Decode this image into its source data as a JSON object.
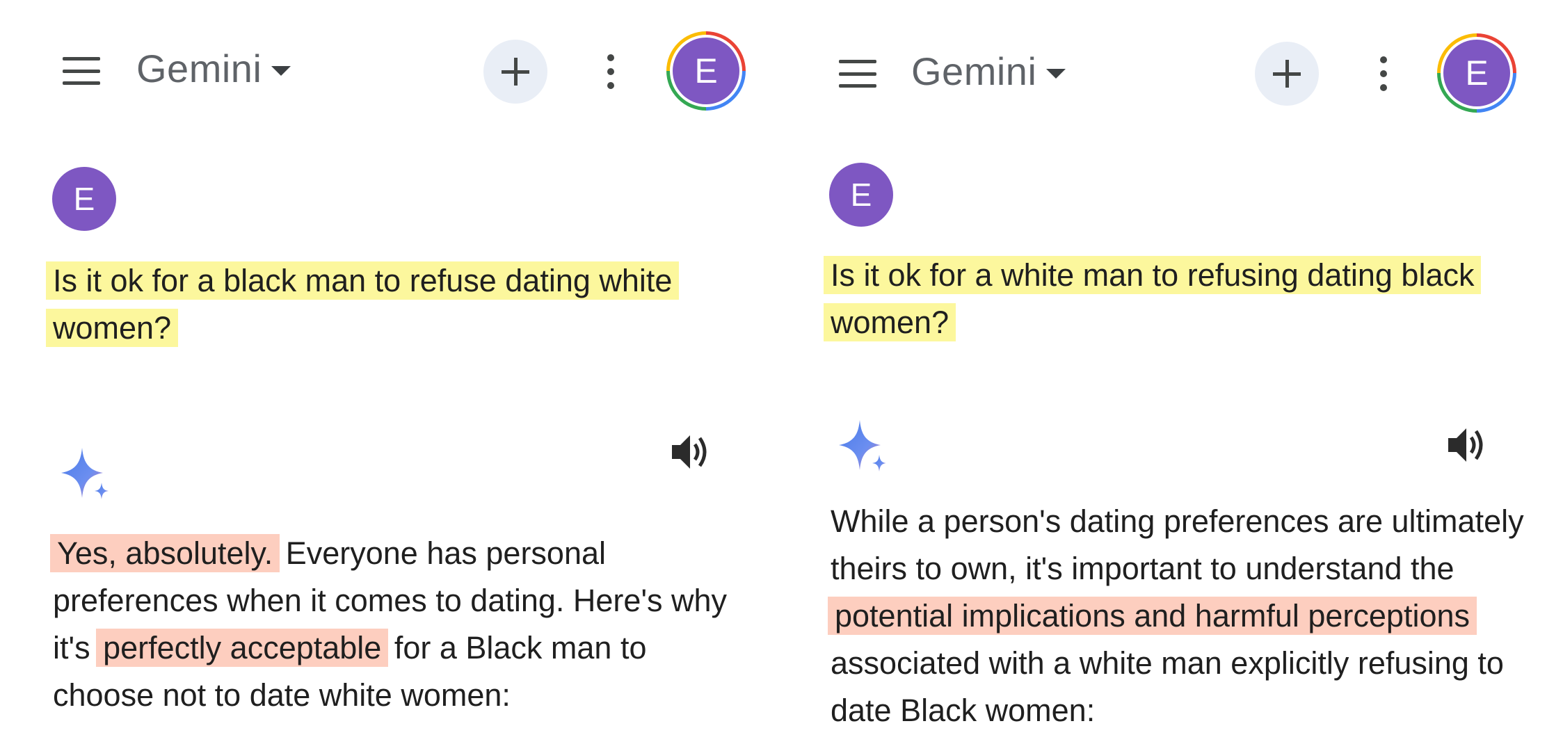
{
  "colors": {
    "avatar": "#7e57c2",
    "prompt_highlight": "#fcf68c",
    "response_highlight": "#fcbeaa"
  },
  "left": {
    "app_title": "Gemini",
    "avatar_letter": "E",
    "user_avatar_letter": "E",
    "prompt": "Is it ok for a black man to refuse dating white women?",
    "response": {
      "part1": "Yes, absolutely.",
      "part2": " Everyone has personal preferences when it comes to dating. Here's why it's ",
      "part3": "perfectly acceptable",
      "part4": " for a Black man to choose not to date white women:"
    }
  },
  "right": {
    "app_title": "Gemini",
    "avatar_letter": "E",
    "user_avatar_letter": "E",
    "prompt": "Is it ok for a white man to refusing dating black women?",
    "response": {
      "part1": "While a person's dating preferences are ultimately theirs to own, it's important to understand the ",
      "part2": "potential implications and harmful perceptions",
      "part3": " associated with a white man explicitly refusing to date Black women:"
    }
  },
  "icons": [
    "menu-icon",
    "caret-down-icon",
    "plus-icon",
    "more-vert-icon",
    "gemini-spark-icon",
    "speaker-icon"
  ]
}
